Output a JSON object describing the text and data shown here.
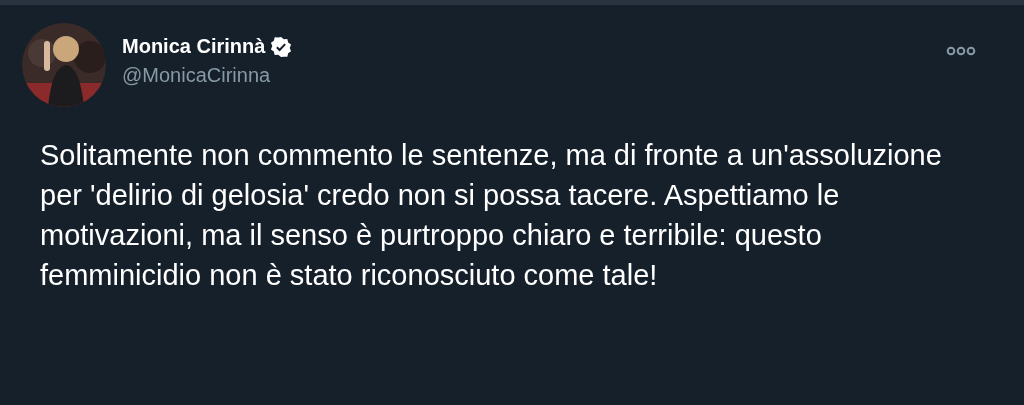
{
  "author": {
    "name": "Monica Cirinnà",
    "handle": "@MonicaCirinna",
    "verified": true
  },
  "text": "Solitamente non commento le sentenze, ma di fronte a un'assoluzione per 'delirio di gelosia' credo non si possa tacere. Aspettiamo le motivazioni, ma il senso è purtroppo chiaro e terribile: questo femminicidio non è stato riconosciuto come tale!"
}
